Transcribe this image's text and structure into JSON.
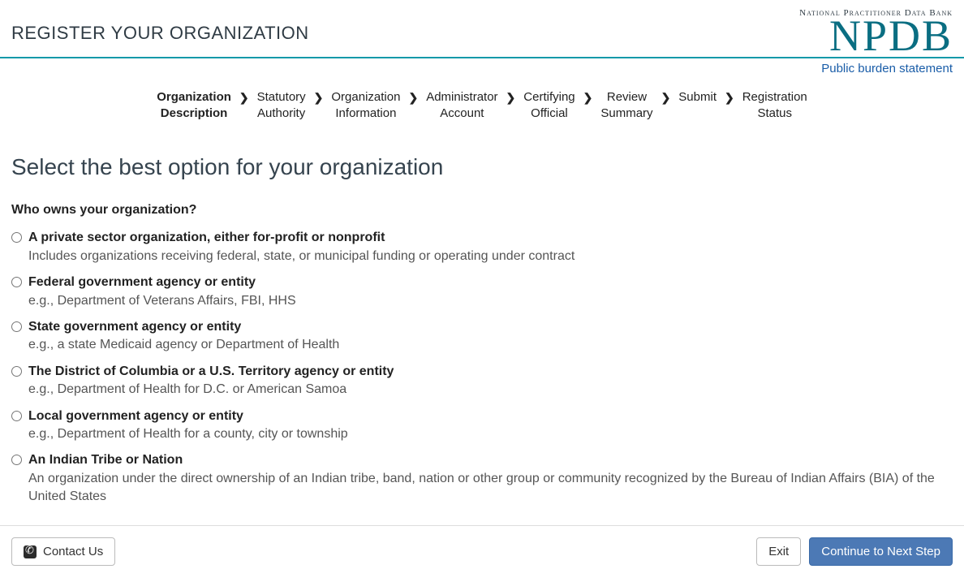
{
  "header": {
    "page_title": "REGISTER YOUR ORGANIZATION",
    "logo_top": "National Practitioner Data Bank",
    "logo_main": "NPDB",
    "burden_link": "Public burden statement"
  },
  "steps": [
    "Organization\nDescription",
    "Statutory\nAuthority",
    "Organization\nInformation",
    "Administrator\nAccount",
    "Certifying\nOfficial",
    "Review\nSummary",
    "Submit",
    "Registration\nStatus"
  ],
  "active_step": 0,
  "main": {
    "section_title": "Select the best option for your organization",
    "question": "Who owns your organization?",
    "options": [
      {
        "title": "A private sector organization, either for-profit or nonprofit",
        "desc": "Includes organizations receiving federal, state, or municipal funding or operating under contract"
      },
      {
        "title": "Federal government agency or entity",
        "desc": "e.g., Department of Veterans Affairs, FBI, HHS"
      },
      {
        "title": "State government agency or entity",
        "desc": "e.g., a state Medicaid agency or Department of Health"
      },
      {
        "title": "The District of Columbia or a U.S. Territory agency or entity",
        "desc": "e.g., Department of Health for D.C. or American Samoa"
      },
      {
        "title": "Local government agency or entity",
        "desc": "e.g., Department of Health for a county, city or township"
      },
      {
        "title": "An Indian Tribe or Nation",
        "desc": "An organization under the direct ownership of an Indian tribe, band, nation or other group or community recognized by the Bureau of Indian Affairs (BIA) of the United States"
      }
    ]
  },
  "footer": {
    "contact": "Contact Us",
    "exit": "Exit",
    "continue": "Continue to Next Step"
  }
}
